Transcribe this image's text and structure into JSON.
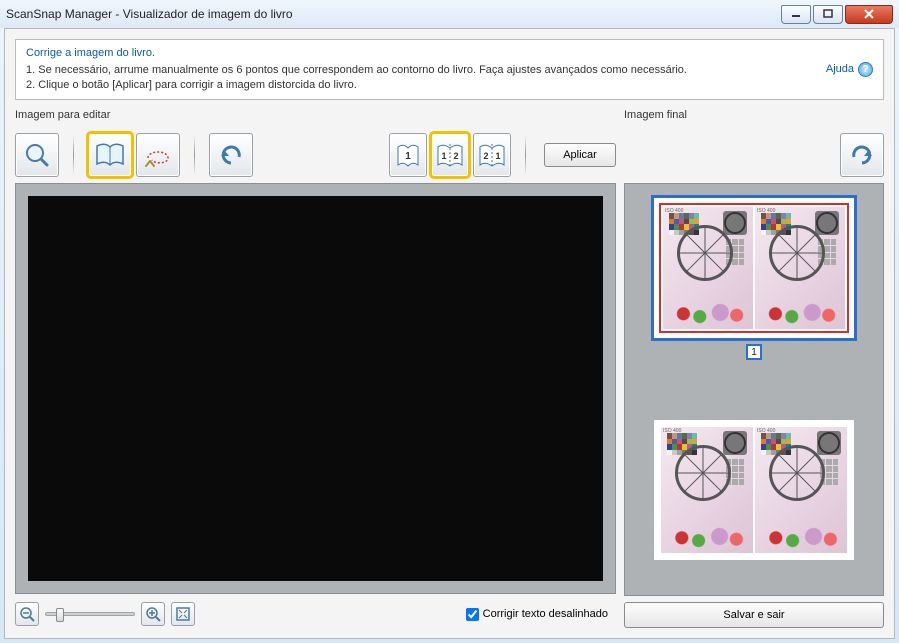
{
  "window": {
    "title": "ScanSnap Manager - Visualizador de imagem do livro"
  },
  "info": {
    "heading": "Corrige a imagem do livro.",
    "line1": "1. Se necessário, arrume manualmente os 6 pontos que correspondem ao contorno do livro. Faça ajustes avançados como necessário.",
    "line2": "2. Clique o botão [Aplicar] para corrigir a imagem distorcida do livro."
  },
  "help": {
    "label": "Ajuda"
  },
  "labels": {
    "edit_panel": "Imagem para editar",
    "final_panel": "Imagem final"
  },
  "toolbar": {
    "apply": "Aplicar"
  },
  "bottom": {
    "correct_skew_label": "Corrigir texto desalinhado",
    "correct_skew_checked": true
  },
  "save_button": "Salvar e sair",
  "thumbnails": {
    "selected_index": 1,
    "badge": "1",
    "iso_label": "ISO 400"
  },
  "colors": {
    "accent_yellow": "#f2c200",
    "accent_blue": "#2c6ecf"
  }
}
